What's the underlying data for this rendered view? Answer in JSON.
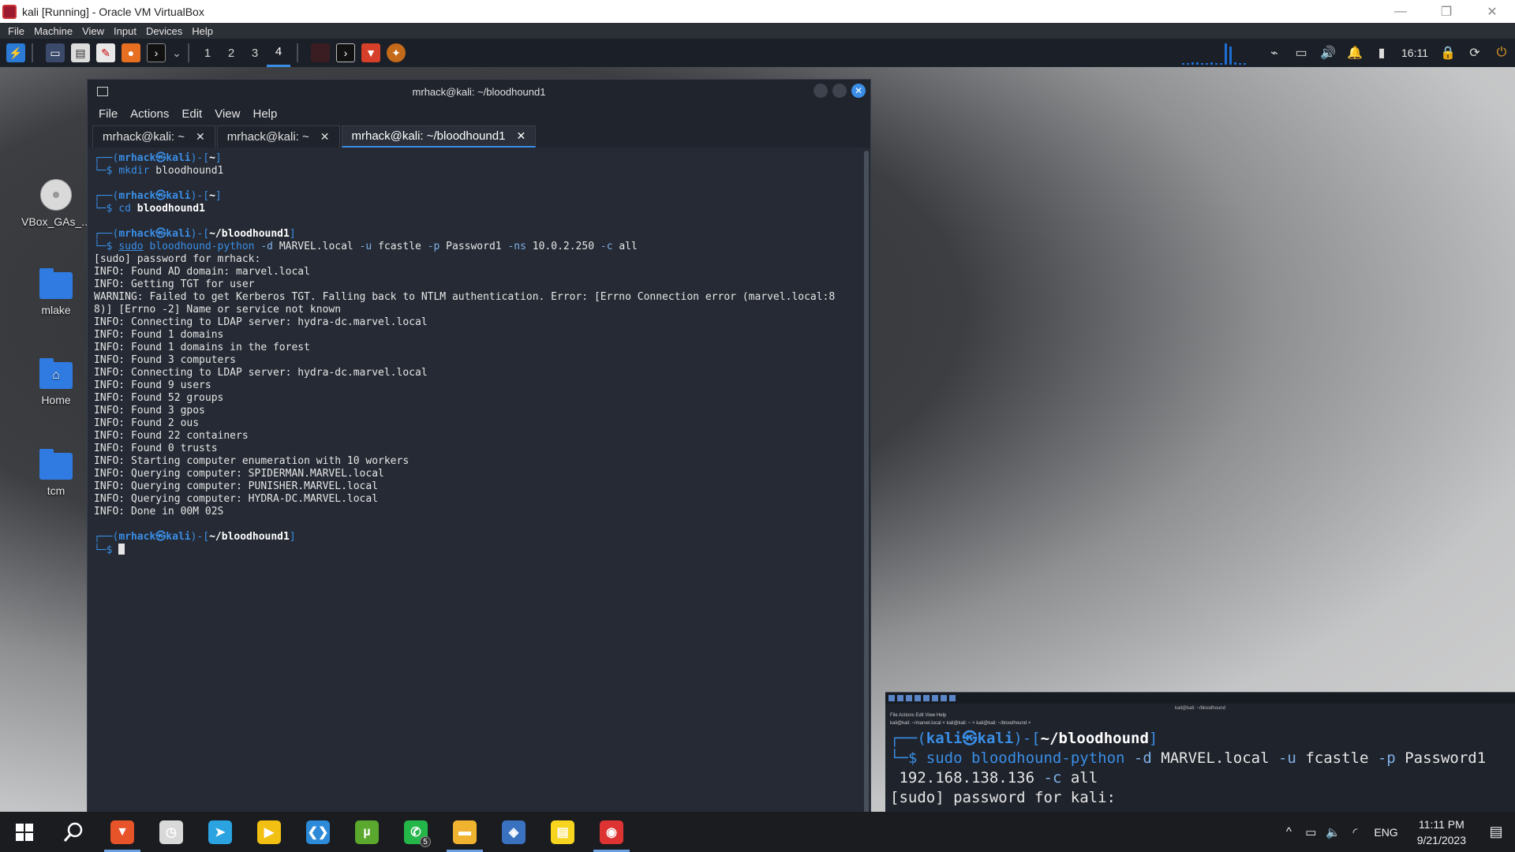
{
  "host": {
    "title": "kali [Running] - Oracle VM VirtualBox",
    "controls": [
      "—",
      "❐",
      "✕"
    ]
  },
  "vbox_menu": [
    "File",
    "Machine",
    "View",
    "Input",
    "Devices",
    "Help"
  ],
  "kali_panel": {
    "workspaces": [
      "1",
      "2",
      "3",
      "4"
    ],
    "active_workspace": "4",
    "clock": "16:11",
    "cpu_bars": [
      2,
      2,
      3,
      3,
      2,
      2,
      3,
      2,
      2,
      30,
      26,
      3,
      2,
      2
    ]
  },
  "desktop_icons": [
    {
      "label": "VBox_GAs_...",
      "kind": "disc"
    },
    {
      "label": "mlake",
      "kind": "folder"
    },
    {
      "label": "Home",
      "kind": "home-folder"
    },
    {
      "label": "tcm",
      "kind": "folder"
    }
  ],
  "terminal": {
    "title": "mrhack@kali: ~/bloodhound1",
    "menu": [
      "File",
      "Actions",
      "Edit",
      "View",
      "Help"
    ],
    "tabs": [
      {
        "label": "mrhack@kali: ~",
        "active": false
      },
      {
        "label": "mrhack@kali: ~",
        "active": false
      },
      {
        "label": "mrhack@kali: ~/bloodhound1",
        "active": true
      }
    ],
    "prompt1": {
      "user": "mrhack",
      "host": "kali",
      "dir": "~",
      "cmd": "mkdir",
      "args": "bloodhound1"
    },
    "prompt2": {
      "user": "mrhack",
      "host": "kali",
      "dir": "~",
      "cmd": "cd",
      "args": "bloodhound1"
    },
    "prompt3": {
      "user": "mrhack",
      "host": "kali",
      "dir": "~/bloodhound1",
      "sudo": "sudo",
      "cmd": "bloodhound-python",
      "f1": "-d",
      "v1": "MARVEL.local",
      "f2": "-u",
      "v2": "fcastle",
      "f3": "-p",
      "v3": "Password1",
      "f4": "-ns",
      "v4": "10.0.2.250",
      "f5": "-c",
      "v5": "all"
    },
    "output": [
      "[sudo] password for mrhack:",
      "INFO: Found AD domain: marvel.local",
      "INFO: Getting TGT for user",
      "WARNING: Failed to get Kerberos TGT. Falling back to NTLM authentication. Error: [Errno Connection error (marvel.local:8",
      "8)] [Errno -2] Name or service not known",
      "INFO: Connecting to LDAP server: hydra-dc.marvel.local",
      "INFO: Found 1 domains",
      "INFO: Found 1 domains in the forest",
      "INFO: Found 3 computers",
      "INFO: Connecting to LDAP server: hydra-dc.marvel.local",
      "INFO: Found 9 users",
      "INFO: Found 52 groups",
      "INFO: Found 3 gpos",
      "INFO: Found 2 ous",
      "INFO: Found 22 containers",
      "INFO: Found 0 trusts",
      "INFO: Starting computer enumeration with 10 workers",
      "INFO: Querying computer: SPIDERMAN.MARVEL.local",
      "INFO: Querying computer: PUNISHER.MARVEL.local",
      "INFO: Querying computer: HYDRA-DC.MARVEL.local",
      "INFO: Done in 00M 02S"
    ],
    "prompt4": {
      "user": "mrhack",
      "host": "kali",
      "dir": "~/bloodhound1"
    }
  },
  "overlay": {
    "mini_title": "kali@kali: ~/bloodhound",
    "mini_menu": "File   Actions   Edit   View   Help",
    "mini_tabs": "kali@kali: ~/marvel.local ×    kali@kali: ~ ×    kali@kali: ~/bloodhound ×",
    "prompt_user": "kali",
    "prompt_host": "kali",
    "prompt_dir": "~/bloodhound",
    "sudo": "sudo",
    "cmd": "bloodhound-python",
    "f1": "-d",
    "v1": "MARVEL.local",
    "f2": "-u",
    "v2": "fcastle",
    "f3": "-p",
    "v3": "Password1",
    "line2": "192.168.138.136",
    "f4": "-c",
    "v4": "all",
    "line3": "[sudo] password for kali:"
  },
  "taskbar": {
    "apps": [
      {
        "name": "brave",
        "glyph": "▼",
        "color": "#e8542a",
        "running": true
      },
      {
        "name": "clock-app",
        "glyph": "◷",
        "color": "#d9d9d9",
        "running": false
      },
      {
        "name": "telegram",
        "glyph": "➤",
        "color": "#2aa3e0",
        "running": false
      },
      {
        "name": "player",
        "glyph": "▶",
        "color": "#f2c012",
        "running": false
      },
      {
        "name": "vscode",
        "glyph": "❮❯",
        "color": "#2d8ad8",
        "running": false
      },
      {
        "name": "utorrent",
        "glyph": "µ",
        "color": "#5aa82d",
        "running": false
      },
      {
        "name": "whatsapp",
        "glyph": "✆",
        "color": "#25b64a",
        "running": false,
        "badge": "5"
      },
      {
        "name": "file-explorer",
        "glyph": "▬",
        "color": "#f0b330",
        "running": true
      },
      {
        "name": "virtualbox",
        "glyph": "◈",
        "color": "#3a72c0",
        "running": false
      },
      {
        "name": "sticky-notes",
        "glyph": "▤",
        "color": "#f7d51e",
        "running": false
      },
      {
        "name": "camera-app",
        "glyph": "◉",
        "color": "#d33",
        "running": true
      }
    ],
    "lang": "ENG",
    "time": "11:11 PM",
    "date": "9/21/2023"
  }
}
